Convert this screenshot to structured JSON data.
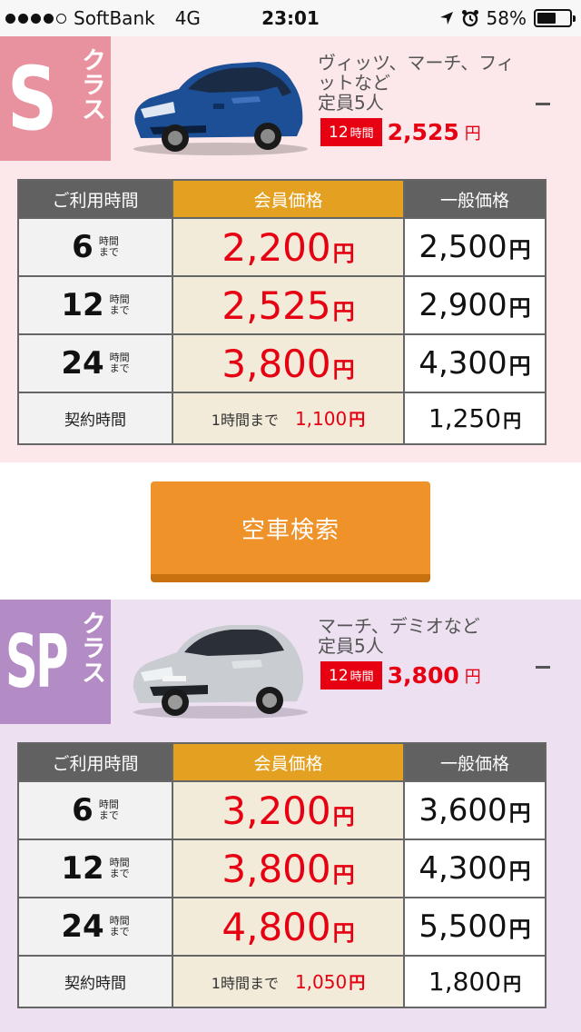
{
  "status": {
    "carrier": "SoftBank",
    "network": "4G",
    "time": "23:01",
    "battery": "58%",
    "battery_level": 0.58
  },
  "header_labels": {
    "duration": "ご利用時間",
    "member": "会員価格",
    "general": "一般価格"
  },
  "duration_unit_top": "時間",
  "duration_unit_bottom": "まで",
  "yen": "円",
  "contract": {
    "label": "契約時間",
    "member_prefix": "1時間まで"
  },
  "search_button": "空車検索",
  "classes": [
    {
      "letter": "S",
      "kana": "クラス",
      "desc_line1": "ヴィッツ、マーチ、フィ",
      "desc_line2": "ットなど",
      "desc_line3": "定員5人",
      "tag_hours": "12",
      "tag_unit": "時間",
      "tag_price": "2,525",
      "toggle": "-",
      "rows": [
        {
          "hours": "6",
          "member": "2,200",
          "general": "2,500"
        },
        {
          "hours": "12",
          "member": "2,525",
          "general": "2,900"
        },
        {
          "hours": "24",
          "member": "3,800",
          "general": "4,300"
        }
      ],
      "contract_member": "1,100",
      "contract_general": "1,250"
    },
    {
      "letter": "SP",
      "kana": "クラス",
      "desc_line1": "マーチ、デミオなど",
      "desc_line2": "定員5人",
      "tag_hours": "12",
      "tag_unit": "時間",
      "tag_price": "3,800",
      "toggle": "-",
      "rows": [
        {
          "hours": "6",
          "member": "3,200",
          "general": "3,600"
        },
        {
          "hours": "12",
          "member": "3,800",
          "general": "4,300"
        },
        {
          "hours": "24",
          "member": "4,800",
          "general": "5,500"
        }
      ],
      "contract_member": "1,050",
      "contract_general": "1,800"
    }
  ],
  "colors": {
    "s_badge": "#e9929f",
    "s_background": "#fce8ea",
    "sp_badge": "#b48cc5",
    "sp_background": "#ece0f1",
    "member_header": "#e3a021",
    "price_red": "#e60012",
    "search_button": "#ef922a"
  }
}
